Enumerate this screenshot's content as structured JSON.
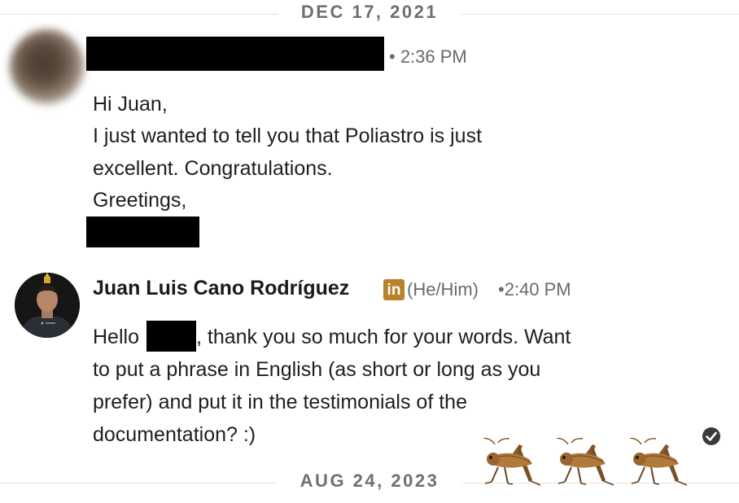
{
  "dividers": [
    {
      "label": "DEC 17, 2021"
    },
    {
      "label": "AUG 24, 2023"
    }
  ],
  "message1": {
    "timestamp": "• 2:36 PM",
    "lines": [
      "Hi Juan,",
      "I just wanted to tell you that Poliastro is just",
      "excellent. Congratulations.",
      "Greetings,"
    ]
  },
  "message2": {
    "sender": "Juan Luis Cano Rodríguez",
    "badge": "in",
    "pronouns": "(He/Him)",
    "timestamp": "•2:40 PM",
    "line1_start": "Hello",
    "line1_end": ", thank you so much for your words. Want",
    "lines": [
      "to put a phrase in English (as short or long as you",
      "prefer) and put it in the testimonials of the",
      "documentation? :)"
    ]
  },
  "colors": {
    "linkedin_badge": "#b8812a",
    "divider": "#e3e3e3",
    "muted_text": "#6a6a6a"
  },
  "icons": [
    "read-receipt-check-icon",
    "cricket-icon"
  ]
}
